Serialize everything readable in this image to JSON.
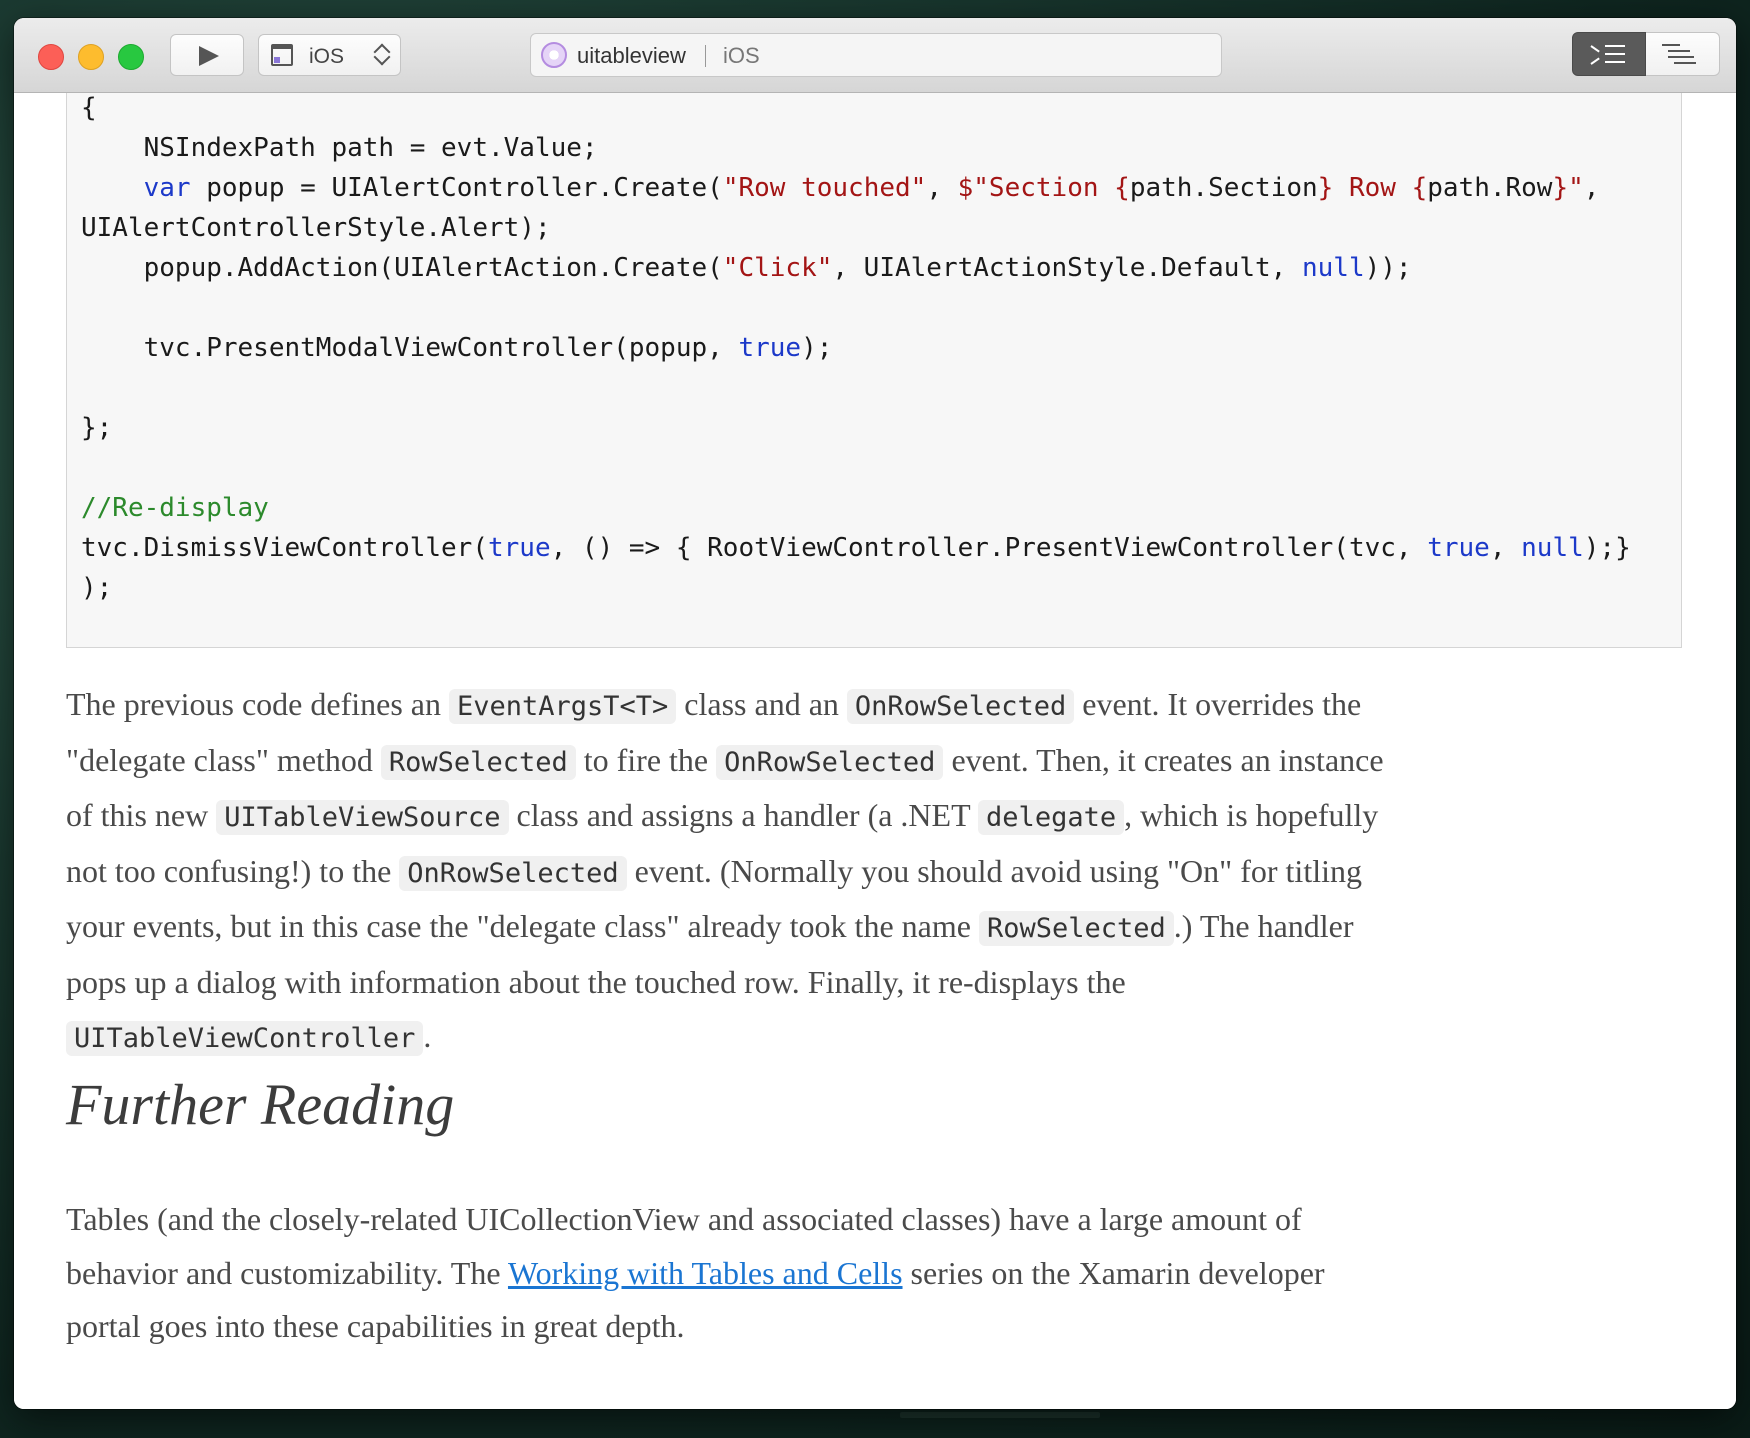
{
  "window": {
    "traffic_lights": [
      "close",
      "minimize",
      "zoom"
    ],
    "toolbar": {
      "run_icon": "play-icon",
      "target_label": "iOS",
      "document_title": "uitableview",
      "document_platform": "iOS",
      "view_toggle_icons": [
        "outline-indent-icon",
        "list-icon"
      ]
    }
  },
  "code_block": {
    "lines": [
      "{",
      "    NSIndexPath path = evt.Value;",
      "    var popup = UIAlertController.Create(\"Row touched\", $\"Section {path.Section} Row {path.Row}\",",
      "UIAlertControllerStyle.Alert);",
      "    popup.AddAction(UIAlertAction.Create(\"Click\", UIAlertActionStyle.Default, null));",
      "",
      "    tvc.PresentModalViewController(popup, true);",
      "",
      "};",
      "",
      "//Re-display",
      "tvc.DismissViewController(true, () => { RootViewController.PresentViewController(tvc, true, null);}",
      ");"
    ]
  },
  "paragraph1": {
    "t1": "The previous code defines an ",
    "c1": "EventArgsT<T>",
    "t2": " class and an ",
    "c2": "OnRowSelected",
    "t3": " event. It overrides the \"delegate class\" method ",
    "c3": "RowSelected",
    "t4": " to fire the ",
    "c4": "OnRowSelected",
    "t5": " event. Then, it creates an instance of this new ",
    "c5": "UITableViewSource",
    "t6": " class and assigns a handler (a .NET ",
    "c6": "delegate",
    "t7": ", which is hopefully not too confusing!) to the ",
    "c7": "OnRowSelected",
    "t8": " event. (Normally you should avoid using \"On\" for titling your events, but in this case the \"delegate class\" already took the name ",
    "c8": "RowSelected",
    "t9": ".) The handler pops up a dialog with information about the touched row. Finally, it re-displays the ",
    "c9": "UITableViewController",
    "t10": "."
  },
  "heading": "Further Reading",
  "paragraph2": {
    "t1": "Tables (and the closely-related UICollectionView and associated classes) have a large amount of behavior and customizability. The ",
    "link": "Working with Tables and Cells",
    "t2": " series on the Xamarin developer portal goes into these capabilities in great depth."
  }
}
